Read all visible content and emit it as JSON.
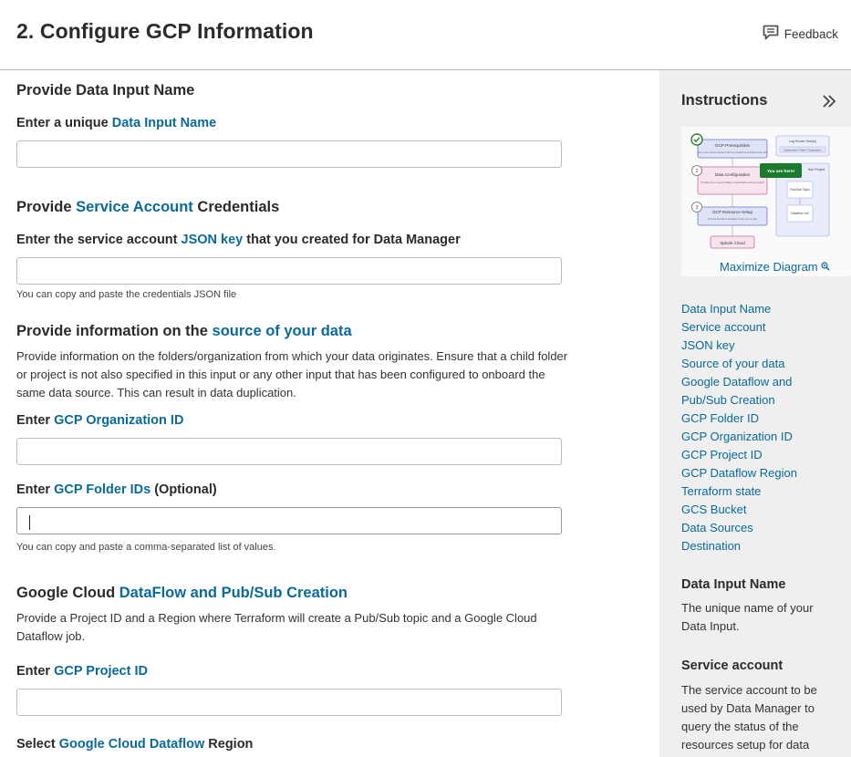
{
  "header": {
    "title": "2. Configure GCP Information",
    "feedback_label": "Feedback"
  },
  "main": {
    "s1": {
      "heading": "Provide Data Input Name",
      "label_pre": "Enter a unique ",
      "label_link": "Data Input Name",
      "input_value": ""
    },
    "s2": {
      "heading_pre": "Provide ",
      "heading_link": "Service Account",
      "heading_post": " Credentials",
      "label_pre": "Enter the service account ",
      "label_link": "JSON key",
      "label_post": " that you created for Data Manager",
      "input_value": "",
      "help": "You can copy and paste the credentials JSON file"
    },
    "s3": {
      "heading_pre": "Provide information on the ",
      "heading_link": "source of your data",
      "para": "Provide information on the folders/organization from which your data originates. Ensure that a child folder or project is not also specified in this input or any other input that has been configured to onboard the same data source. This can result in data duplication.",
      "org_label_pre": "Enter ",
      "org_label_link": "GCP Organization ID",
      "org_value": "",
      "folder_label_pre": "Enter ",
      "folder_label_link": "GCP Folder IDs",
      "folder_label_post": " (Optional)",
      "folder_value": "",
      "folder_help": "You can copy and paste a comma-separated list of values."
    },
    "s4": {
      "heading_pre": "Google Cloud ",
      "heading_link": "DataFlow and Pub/Sub Creation",
      "para": "Provide a Project ID and a Region where Terraform will create a Pub/Sub topic and a Google Cloud Dataflow job.",
      "project_label_pre": "Enter ",
      "project_label_link": "GCP Project ID",
      "project_value": "",
      "region_label_pre": "Select ",
      "region_label_link": "Google Cloud Dataflow",
      "region_label_post": " Region"
    }
  },
  "sidebar": {
    "title": "Instructions",
    "diagram": {
      "step1": "GCP Prerequisites",
      "step2": "Data Configuration",
      "step3": "GCP Resource Setup",
      "final": "Splunk Cloud",
      "you_are_here": "You are here!",
      "right_top": "Log Router Sink(s)",
      "right_sub": "Organization / Folder / Organization",
      "hub_project": "Hub Project",
      "pubsub": "Pub/Sub Topic",
      "dataflow": "Dataflow Job",
      "mini_text_1": "Set up the service account with the required permissions and roles",
      "mini_text_2": "Provide info on source folders / organization and Hub project",
      "mini_text_3": "Run the Terraform template on the source side"
    },
    "maximize_label": "Maximize Diagram",
    "links": [
      "Data Input Name",
      "Service account",
      "JSON key",
      "Source of your data",
      "Google Dataflow and",
      "Pub/Sub Creation",
      "GCP Folder ID",
      "GCP Organization ID",
      "GCP Project ID",
      "GCP Dataflow Region",
      "Terraform state",
      "GCS Bucket",
      "Data Sources",
      "Destination"
    ],
    "sec1_title": "Data Input Name",
    "sec1_body": "The unique name of your Data Input.",
    "sec2_title": "Service account",
    "sec2_body": "The service account to be used by Data Manager to query the status of the resources setup for data"
  }
}
